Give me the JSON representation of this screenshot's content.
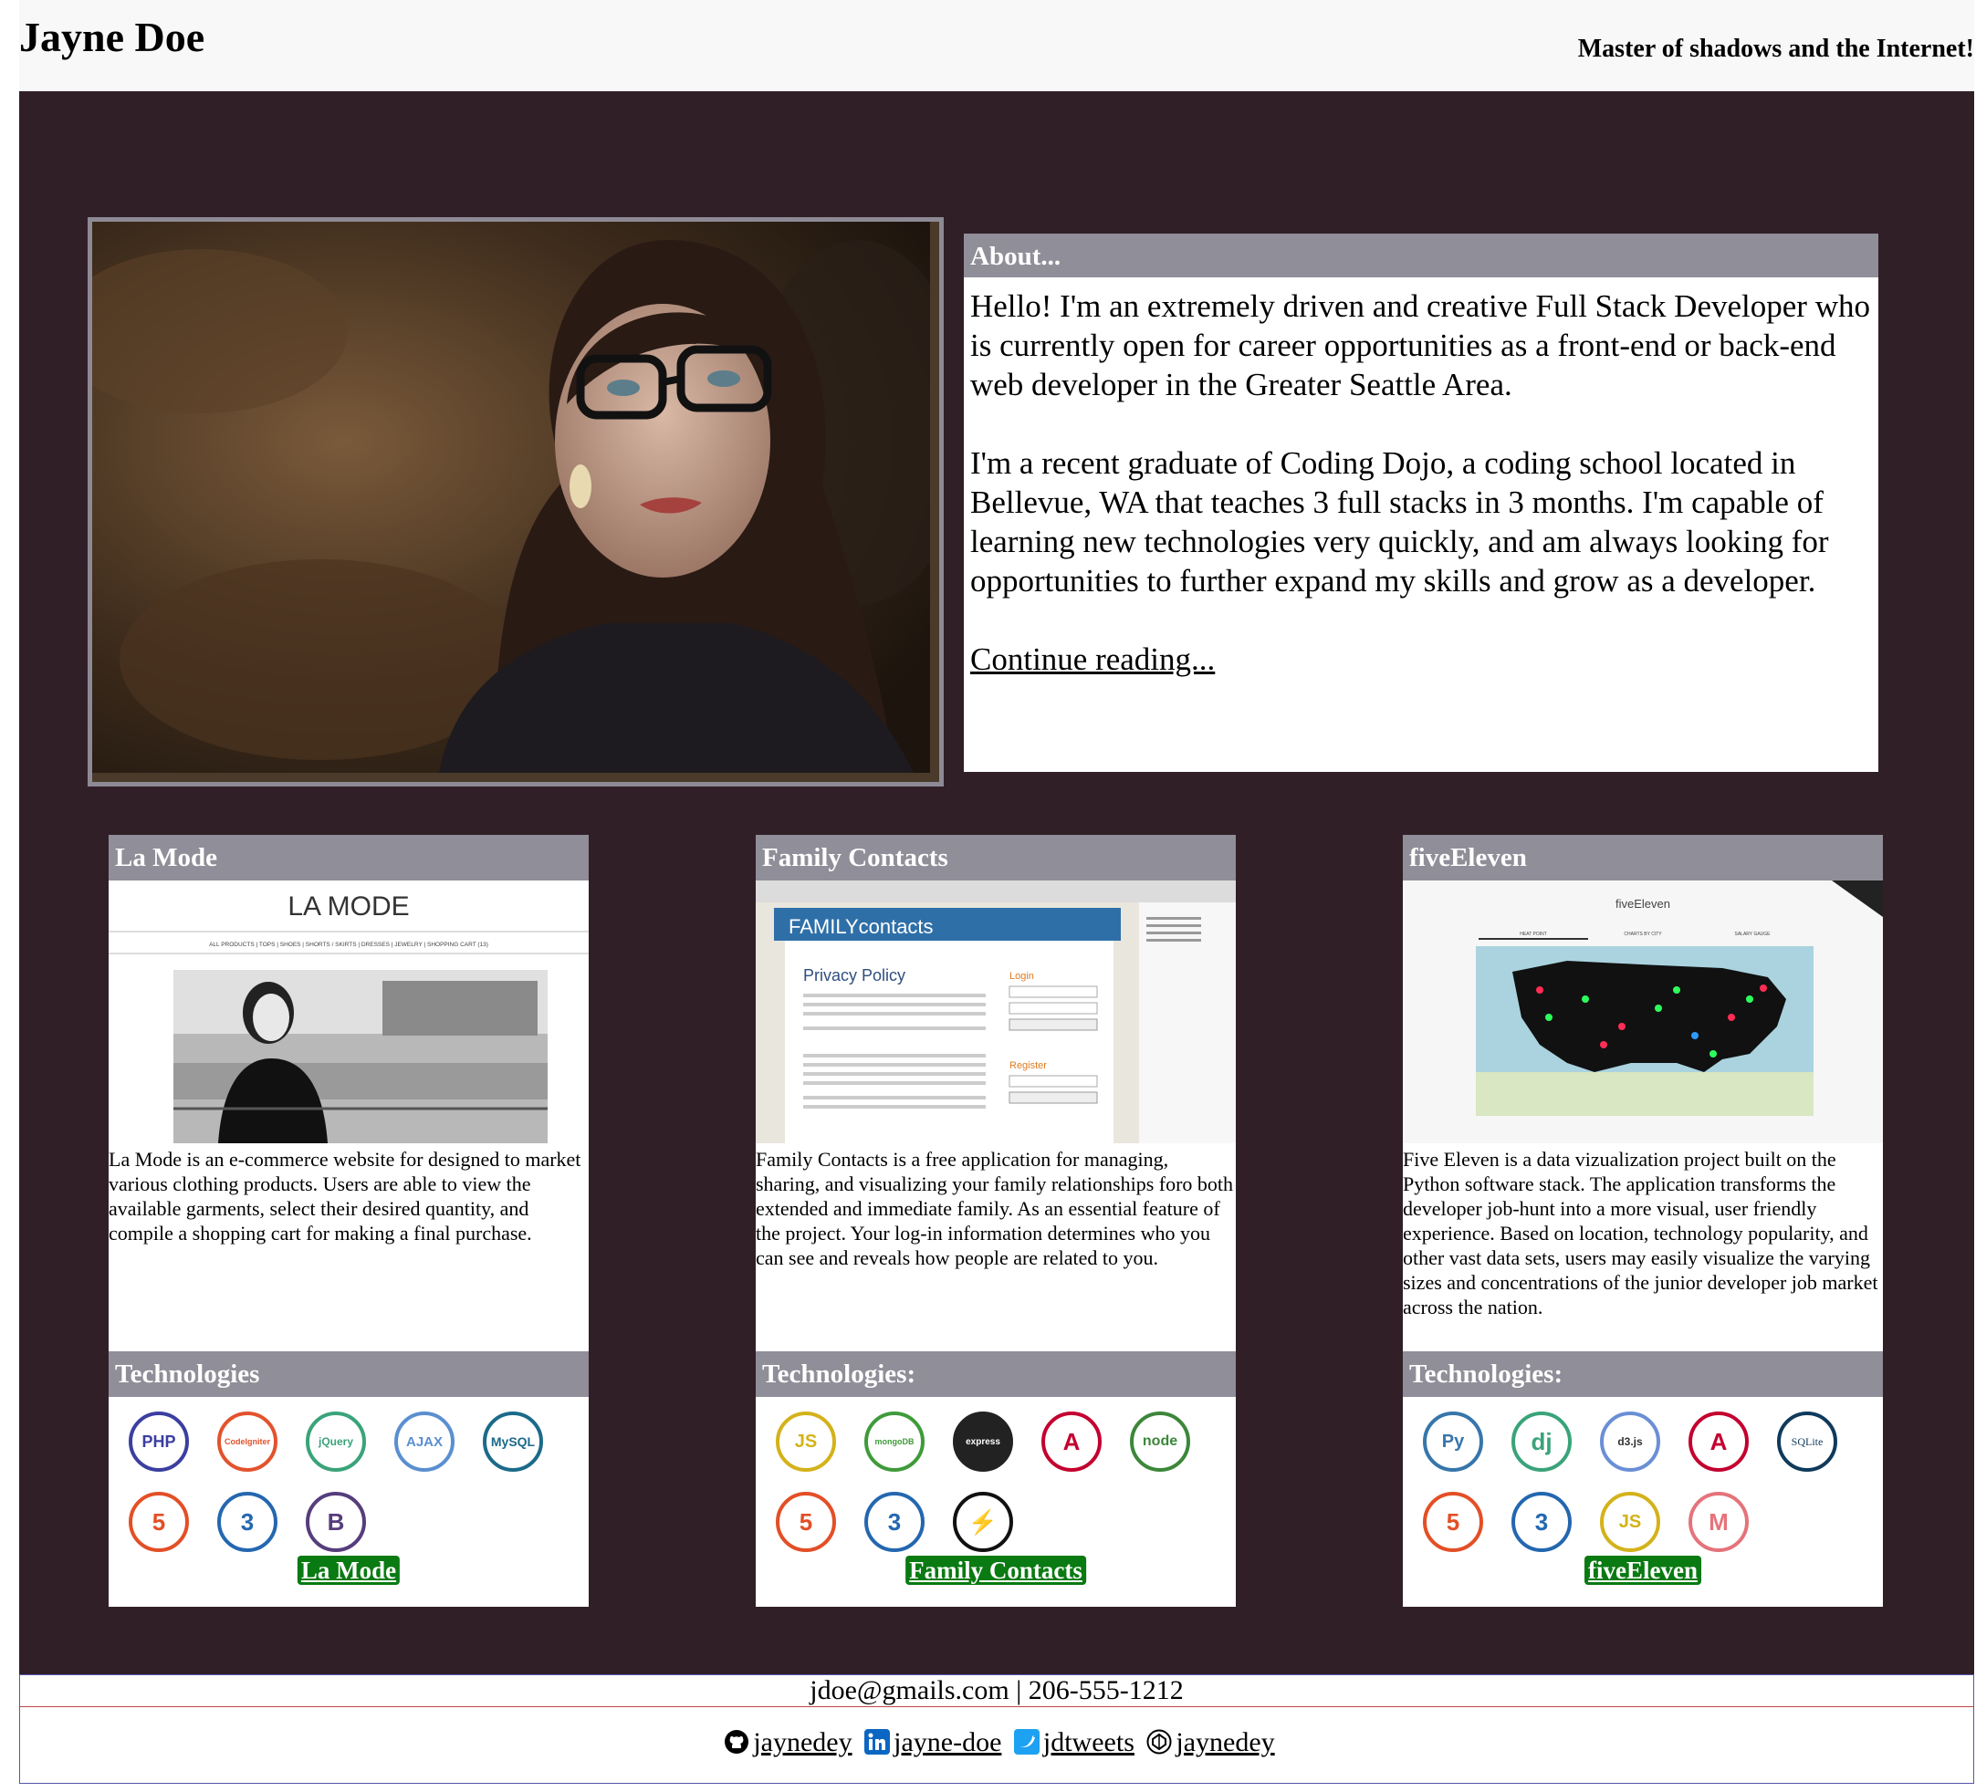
{
  "header": {
    "title": "Jayne Doe",
    "tagline": "Master of shadows and the Internet!"
  },
  "about": {
    "heading": "About...",
    "paragraph1": "Hello! I'm an extremely driven and creative Full Stack Developer who is currently open for career opportunities as a front-end or back-end web developer in the Greater Seattle Area.",
    "paragraph2": "I'm a recent graduate of Coding Dojo, a coding school located in Bellevue, WA that teaches 3 full stacks in 3 months. I'm capable of learning new technologies very quickly, and am always looking for opportunities to further expand my skills and grow as a developer.",
    "link": "Continue reading..."
  },
  "projects": [
    {
      "title": "La Mode",
      "screenshot_text": "LA MODE",
      "screenshot_nav": "ALL PRODUCTS | TOPS | SHOES | SHORTS / SKIRTS | DRESSES | JEWELRY | SHOPPING CART (13)",
      "description": "La Mode is an e-commerce website for designed to market various clothing products. Users are able to view the available garments, select their desired quantity, and compile a shopping cart for making a final purchase.",
      "tech_heading": "Technologies",
      "technologies": [
        {
          "icon": "php-icon",
          "label": "PHP",
          "color": "#3b3fa0"
        },
        {
          "icon": "codeigniter-icon",
          "label": "CodeIgniter",
          "color": "#e2532d"
        },
        {
          "icon": "jquery-icon",
          "label": "jQuery",
          "color": "#3aa37a"
        },
        {
          "icon": "ajax-icon",
          "label": "AJAX",
          "color": "#5a8fd0"
        },
        {
          "icon": "mysql-icon",
          "label": "MySQL",
          "color": "#1b6a8a"
        },
        {
          "icon": "html5-icon",
          "label": "5",
          "color": "#e34f26"
        },
        {
          "icon": "css3-icon",
          "label": "3",
          "color": "#2467b0"
        },
        {
          "icon": "bootstrap-icon",
          "label": "B",
          "color": "#563d7c"
        }
      ],
      "button": "La Mode"
    },
    {
      "title": "Family Contacts",
      "screenshot_text": "FAMILYcontacts",
      "screenshot_heading": "Privacy Policy",
      "screenshot_login": "Login",
      "screenshot_register": "Register",
      "description": "Family Contacts is a free application for managing, sharing, and visualizing your family relationships foro both extended and immediate family. As an essential feature of the project. Your log-in information determines who you can see and reveals how people are related to you.",
      "tech_heading": "Technologies:",
      "technologies": [
        {
          "icon": "javascript-icon",
          "label": "JS",
          "color": "#d4b21a"
        },
        {
          "icon": "mongodb-icon",
          "label": "mongoDB",
          "color": "#3f9b3a"
        },
        {
          "icon": "express-icon",
          "label": "express",
          "color": "#222222"
        },
        {
          "icon": "angular-icon",
          "label": "A",
          "color": "#c3002f"
        },
        {
          "icon": "node-icon",
          "label": "node",
          "color": "#3c873a"
        },
        {
          "icon": "html5-icon",
          "label": "5",
          "color": "#e34f26"
        },
        {
          "icon": "css3-icon",
          "label": "3",
          "color": "#2467b0"
        },
        {
          "icon": "socketio-icon",
          "label": "⚡",
          "color": "#111111"
        }
      ],
      "button": "Family Contacts"
    },
    {
      "title": "fiveEleven",
      "screenshot_text": "fiveEleven",
      "screenshot_tabs": [
        "HEAT POINT",
        "CHARTS BY CITY",
        "SALARY GAUGE"
      ],
      "description": "Five Eleven is a data vizualization project built on the Python software stack. The application transforms the developer job-hunt into a more visual, user friendly experience. Based on location, technology popularity, and other vast data sets, users may easily visualize the varying sizes and concentrations of the junior developer job market across the nation.",
      "tech_heading": "Technologies:",
      "technologies": [
        {
          "icon": "python-icon",
          "label": "Py",
          "color": "#3776ab"
        },
        {
          "icon": "django-icon",
          "label": "dj",
          "color": "#3aa37a"
        },
        {
          "icon": "d3-icon",
          "label": "d3.js",
          "color": "#6b8fd6"
        },
        {
          "icon": "angular-icon",
          "label": "A",
          "color": "#c3002f"
        },
        {
          "icon": "sqlite-icon",
          "label": "SQLite",
          "color": "#0f3a5c"
        },
        {
          "icon": "html5-icon",
          "label": "5",
          "color": "#e34f26"
        },
        {
          "icon": "css3-icon",
          "label": "3",
          "color": "#2467b0"
        },
        {
          "icon": "javascript-icon",
          "label": "JS",
          "color": "#d4b21a"
        },
        {
          "icon": "materialize-icon",
          "label": "M",
          "color": "#e5737b"
        }
      ],
      "button": "fiveEleven"
    }
  ],
  "footer": {
    "contact": "jdoe@gmails.com | 206-555-1212",
    "social": [
      {
        "icon": "github-icon",
        "label": "jaynedey"
      },
      {
        "icon": "linkedin-icon",
        "label": "jayne-doe"
      },
      {
        "icon": "twitter-icon",
        "label": "jdtweets"
      },
      {
        "icon": "codepen-icon",
        "label": "jaynedey"
      }
    ]
  }
}
